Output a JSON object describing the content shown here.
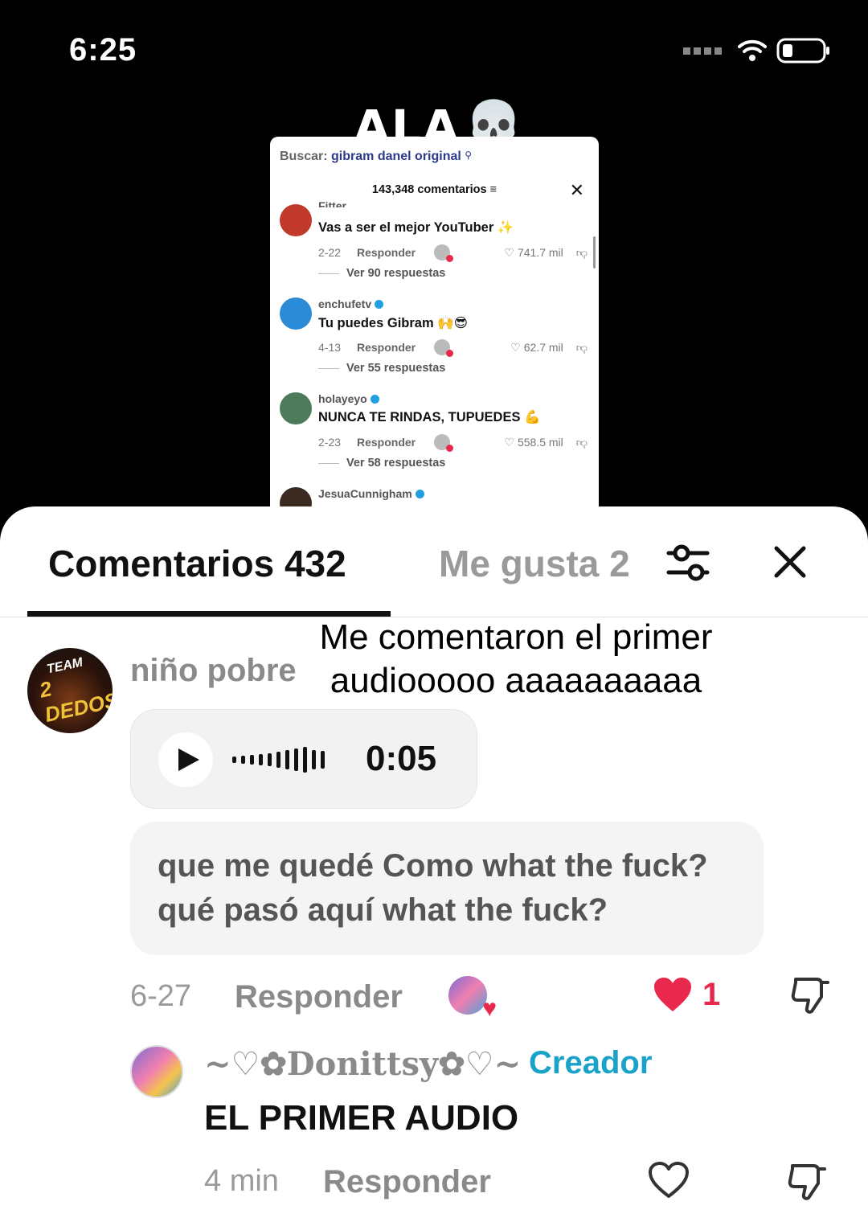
{
  "status_bar": {
    "time": "6:25"
  },
  "video": {
    "overlay_title": "ALA",
    "embedded": {
      "search_label": "Buscar:",
      "search_query": "gibram danel original",
      "header": "143,348 comentarios",
      "comments": [
        {
          "user": "Fitter",
          "text": "Vas a ser el mejor YouTuber ✨",
          "date": "2-22",
          "reply": "Responder",
          "likes": "741.7 mil",
          "replies": "Ver 90 respuestas",
          "avatar_color": "#c0392b"
        },
        {
          "user": "enchufetv",
          "text": "Tu puedes Gibram 🙌😎",
          "date": "4-13",
          "reply": "Responder",
          "likes": "62.7 mil",
          "replies": "Ver 55 respuestas",
          "avatar_color": "#2c8bd6"
        },
        {
          "user": "holayeyo",
          "text": "NUNCA TE RINDAS, TUPUEDES 💪",
          "date": "2-23",
          "reply": "Responder",
          "likes": "558.5 mil",
          "replies": "Ver 58 respuestas",
          "avatar_color": "#4d7a5a"
        },
        {
          "user": "JesuaCunnigham",
          "text": "",
          "date": "",
          "reply": "",
          "likes": "",
          "replies": "",
          "avatar_color": "#3a2a22"
        }
      ]
    }
  },
  "sheet": {
    "tabs": {
      "comments": "Comentarios 432",
      "likes": "Me gusta 2"
    },
    "overlay_caption_line1": "Me comentaron el primer",
    "overlay_caption_line2": "audiooooo aaaaaaaaaa",
    "comment": {
      "avatar_text_top": "TEAM",
      "avatar_text_bottom": "2 DEDOS",
      "username": "niño pobre",
      "audio_duration": "0:05",
      "transcript_line1": "que me quedé Como what the fuck?",
      "transcript_line2": "qué pasó aquí what the fuck?",
      "date": "6-27",
      "reply": "Responder",
      "like_count": "1",
      "like_color": "#e8294d"
    },
    "reply": {
      "username": "~♡✿Donittsy✿♡~",
      "separator": "·",
      "badge": "Creador",
      "badge_color": "#1aa3c9",
      "text": "EL PRIMER AUDIO",
      "date": "4 min",
      "reply": "Responder"
    }
  }
}
